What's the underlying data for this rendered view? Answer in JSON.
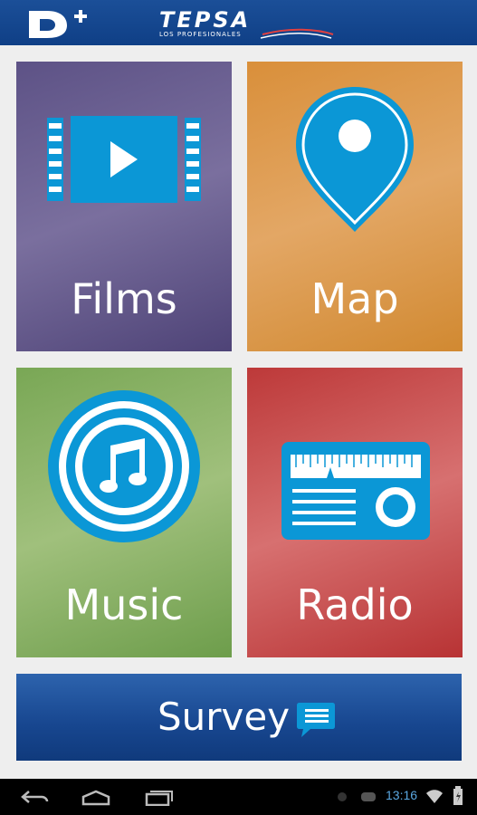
{
  "header": {
    "logo_left_icon": "d-plus-logo-icon",
    "brand_name": "TEPSA",
    "brand_tagline": "LOS PROFESIONALES"
  },
  "tiles": [
    {
      "label": "Films",
      "icon": "film-strip-play-icon",
      "color": "#6a5f91"
    },
    {
      "label": "Map",
      "icon": "map-pin-icon",
      "color": "#dd9a4c"
    },
    {
      "label": "Music",
      "icon": "music-note-icon",
      "color": "#86b064"
    },
    {
      "label": "Radio",
      "icon": "radio-icon",
      "color": "#c65050"
    }
  ],
  "survey": {
    "label": "Survey",
    "icon": "chat-bubble-icon",
    "color": "#1f519a"
  },
  "accent": "#0b97d6",
  "statusbar": {
    "time": "13:16",
    "icons": [
      "settings-dot-icon",
      "gamepad-icon",
      "wifi-icon",
      "battery-icon"
    ]
  },
  "navbar": {
    "icons": [
      "back-icon",
      "home-icon",
      "recent-apps-icon"
    ]
  }
}
